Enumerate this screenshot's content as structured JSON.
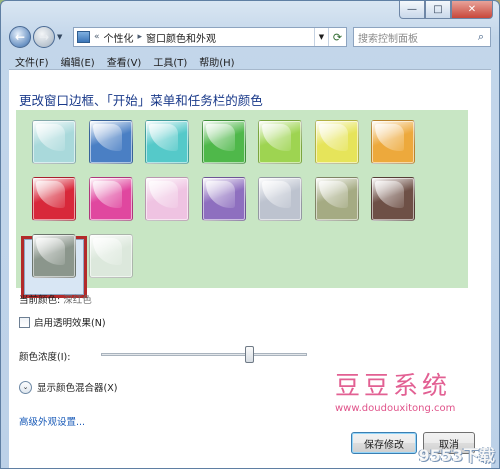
{
  "window": {
    "caption_buttons": {
      "minimize": "—",
      "maximize": "□",
      "close": "✕"
    }
  },
  "nav": {
    "back_glyph": "←",
    "forward_glyph": "→",
    "breadcrumb_overflow": "«",
    "breadcrumb": [
      "个性化",
      "窗口颜色和外观"
    ],
    "search_placeholder": "搜索控制面板"
  },
  "menu": [
    "文件(F)",
    "编辑(E)",
    "查看(V)",
    "工具(T)",
    "帮助(H)"
  ],
  "content": {
    "heading": "更改窗口边框、「开始」菜单和任务栏的颜色",
    "swatches": [
      {
        "name": "sky",
        "color": "#a9d9db"
      },
      {
        "name": "twilight",
        "color": "#4a7fc4"
      },
      {
        "name": "sea",
        "color": "#55c9c9"
      },
      {
        "name": "leaf",
        "color": "#4fb84a"
      },
      {
        "name": "lime",
        "color": "#9ed451"
      },
      {
        "name": "lemon",
        "color": "#e6e45a"
      },
      {
        "name": "pumpkin",
        "color": "#eda93c"
      },
      {
        "name": "ruby",
        "color": "#d8283a"
      },
      {
        "name": "fuchsia",
        "color": "#e0479f"
      },
      {
        "name": "blush",
        "color": "#efc3e2"
      },
      {
        "name": "violet",
        "color": "#8e6fbf"
      },
      {
        "name": "lavender",
        "color": "#bdc3cf"
      },
      {
        "name": "taupe",
        "color": "#a5ab83"
      },
      {
        "name": "chocolate",
        "color": "#6e5046"
      },
      {
        "name": "slate",
        "color": "#8b968c"
      },
      {
        "name": "frost",
        "color": "#dce8dc"
      }
    ],
    "selected_index": 7,
    "current_color_label": "当前颜色:",
    "current_color_value": "深红色",
    "transparency_label": "启用透明效果(N)",
    "transparency_checked": false,
    "intensity_label": "颜色浓度(I):",
    "intensity_fraction": 0.72,
    "mixer_label": "显示颜色混合器(X)",
    "advanced_link": "高级外观设置...",
    "save_button": "保存修改",
    "cancel_button": "取消"
  },
  "watermark": {
    "text": "豆豆系统",
    "url": "www.doudouxitong.com",
    "corner": "9553下载"
  },
  "colors": {
    "selection_frame": "#b22a2a",
    "swatch_panel_bg": "#c8e6c4",
    "heading": "#1a3a8a",
    "link": "#1a5bb8",
    "watermark": "#e0538a"
  }
}
